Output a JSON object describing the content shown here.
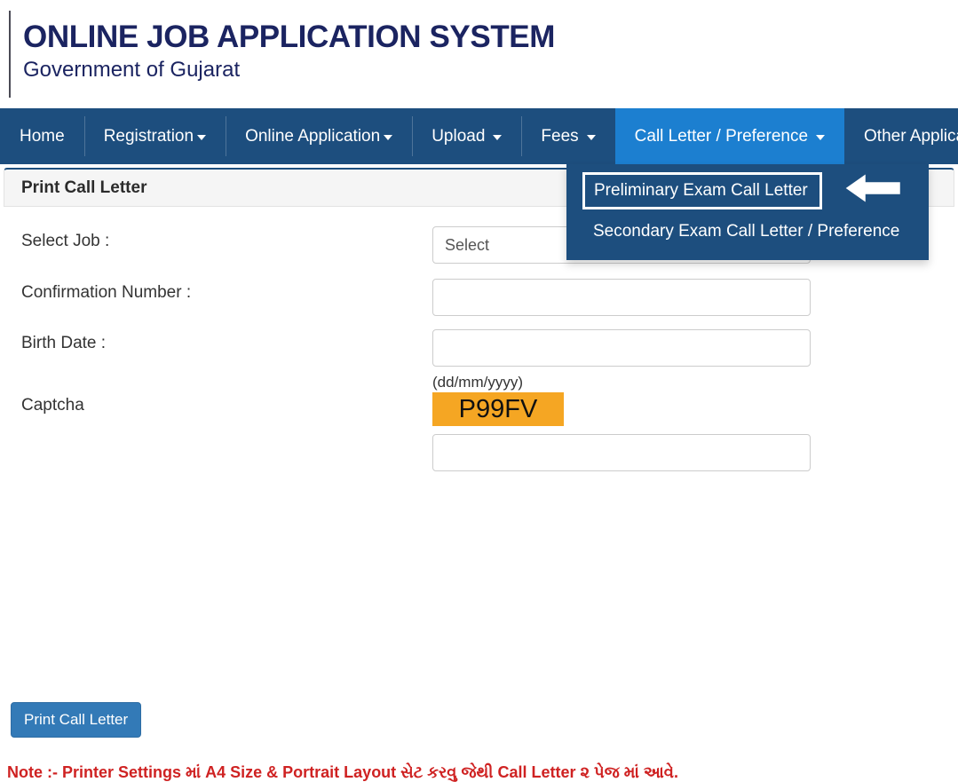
{
  "header": {
    "title": "ONLINE JOB APPLICATION SYSTEM",
    "subtitle": "Government of Gujarat"
  },
  "nav": {
    "items": [
      {
        "label": "Home",
        "has_caret": false,
        "active": false
      },
      {
        "label": "Registration",
        "has_caret": true,
        "active": false
      },
      {
        "label": "Online Application",
        "has_caret": true,
        "active": false
      },
      {
        "label": "Upload",
        "has_caret": true,
        "active": false
      },
      {
        "label": "Fees",
        "has_caret": true,
        "active": false
      },
      {
        "label": "Call Letter / Preference",
        "has_caret": true,
        "active": true
      },
      {
        "label": "Other Application",
        "has_caret": true,
        "active": false
      }
    ]
  },
  "dropdown": {
    "items": [
      {
        "label": "Preliminary Exam Call Letter",
        "highlighted": true
      },
      {
        "label": "Secondary Exam Call Letter / Preference",
        "highlighted": false
      }
    ]
  },
  "panel": {
    "title": "Print Call Letter"
  },
  "form": {
    "select_job": {
      "label": "Select Job :",
      "value": "Select",
      "options": [
        "Select"
      ]
    },
    "confirmation_number": {
      "label": "Confirmation Number :",
      "value": "",
      "placeholder": ""
    },
    "birth_date": {
      "label": "Birth Date :",
      "value": "",
      "placeholder": "",
      "helper": "(dd/mm/yyyy)"
    },
    "captcha": {
      "label": "Captcha",
      "image_text": "P99FV",
      "value": "",
      "placeholder": ""
    },
    "submit_label": "Print Call Letter"
  },
  "note": "Note :- Printer Settings માં A4 Size & Portrait Layout સેટ કરવુ જેથી Call Letter ૨ પેજ માં આવે.",
  "colors": {
    "nav_bg": "#1d4e7e",
    "nav_active": "#1c7fd0",
    "brand": "#1b2461",
    "captcha_bg": "#f5a623",
    "button": "#337ab7",
    "note": "#cf2222"
  }
}
